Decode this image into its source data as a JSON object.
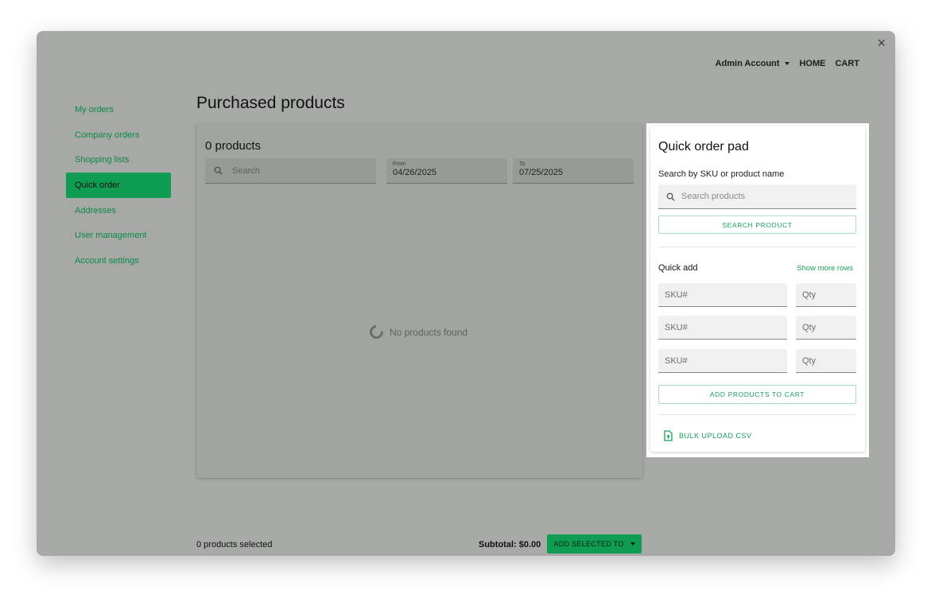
{
  "header": {
    "account_label": "Admin Account",
    "home_label": "HOME",
    "cart_label": "CART"
  },
  "window": {
    "close_glyph": "×"
  },
  "sidebar": {
    "items": [
      {
        "label": "My orders"
      },
      {
        "label": "Company orders"
      },
      {
        "label": "Shopping lists"
      },
      {
        "label": "Quick order"
      },
      {
        "label": "Addresses"
      },
      {
        "label": "User management"
      },
      {
        "label": "Account settings"
      }
    ],
    "active_index": 3
  },
  "page": {
    "title": "Purchased products"
  },
  "products": {
    "count_label": "0 products",
    "search_placeholder": "Search",
    "from_label": "From",
    "from_value": "04/26/2025",
    "to_label": "To",
    "to_value": "07/25/2025",
    "empty_text": "No products found"
  },
  "footer": {
    "selected_text": "0 products selected",
    "subtotal_text": "Subtotal: $0.00",
    "add_selected_label": "ADD SELECTED TO"
  },
  "quick_order": {
    "title": "Quick order pad",
    "search_label": "Search by SKU or product name",
    "search_placeholder": "Search products",
    "search_button": "SEARCH PRODUCT",
    "quick_add_label": "Quick add",
    "show_more_label": "Show more rows",
    "rows": [
      {
        "sku_placeholder": "SKU#",
        "qty_placeholder": "Qty"
      },
      {
        "sku_placeholder": "SKU#",
        "qty_placeholder": "Qty"
      },
      {
        "sku_placeholder": "SKU#",
        "qty_placeholder": "Qty"
      }
    ],
    "add_to_cart_button": "ADD PRODUCTS TO CART",
    "bulk_upload_label": "BULK UPLOAD CSV"
  },
  "colors": {
    "accent": "#0e9d53",
    "accent_text": "#1aa05a",
    "overlay_bg": "#a7a9a7"
  },
  "icons": {
    "close": "close-icon",
    "search": "search-icon",
    "spinner": "loading-spinner-icon",
    "upload": "file-upload-icon",
    "dropdown": "caret-down-icon"
  }
}
